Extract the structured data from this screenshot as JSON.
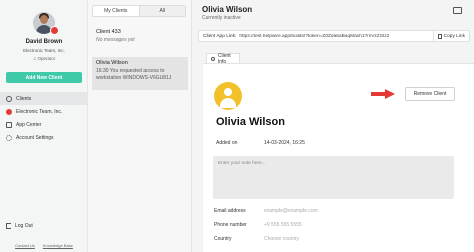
{
  "user": {
    "name": "David Brown",
    "team": "Electronic Team, Inc.",
    "role": "Operator"
  },
  "sidebar": {
    "add_button": "Add New Client",
    "items": [
      {
        "label": "Clients",
        "icon": "clients-icon"
      },
      {
        "label": "Electronic Team, Inc.",
        "icon": "team-icon"
      },
      {
        "label": "App Center",
        "icon": "apps-icon"
      },
      {
        "label": "Account Settings",
        "icon": "settings-icon"
      }
    ],
    "logout": "Log Out",
    "footer": [
      "Contact Us",
      "Knowledge Base"
    ]
  },
  "list": {
    "tabs": [
      "My Clients",
      "All"
    ],
    "conversations": [
      {
        "title": "Client 433",
        "message": "No messages yet"
      },
      {
        "title": "Olivia Wilson",
        "message": "16:30  You requested access to workstation WINDOWS-V6GU81J"
      }
    ]
  },
  "main": {
    "header_name": "Olivia Wilson",
    "header_status": "Currently inactive",
    "app_link_label": "Client App Link:",
    "app_link_url": "https://test.helpwire.app/builds/?token=Z0Zda6aBaqMaxh1?mVzZSIz2",
    "copy_link": "Copy Link",
    "tab_label": "Client Info",
    "remove_button": "Remove Client",
    "client_name": "Olivia Wilson",
    "added_label": "Added on",
    "added_value": "14-03-2024, 16:25",
    "note_placeholder": "Enter your note here...",
    "fields": [
      {
        "label": "Email address",
        "value": "example@example.com"
      },
      {
        "label": "Phone number",
        "value": "+9 555 555 5555"
      },
      {
        "label": "Country",
        "value": "Choose country"
      }
    ]
  },
  "colors": {
    "accent": "#3ec9a7",
    "arrow": "#e53935",
    "avatar": "#f2c028"
  }
}
